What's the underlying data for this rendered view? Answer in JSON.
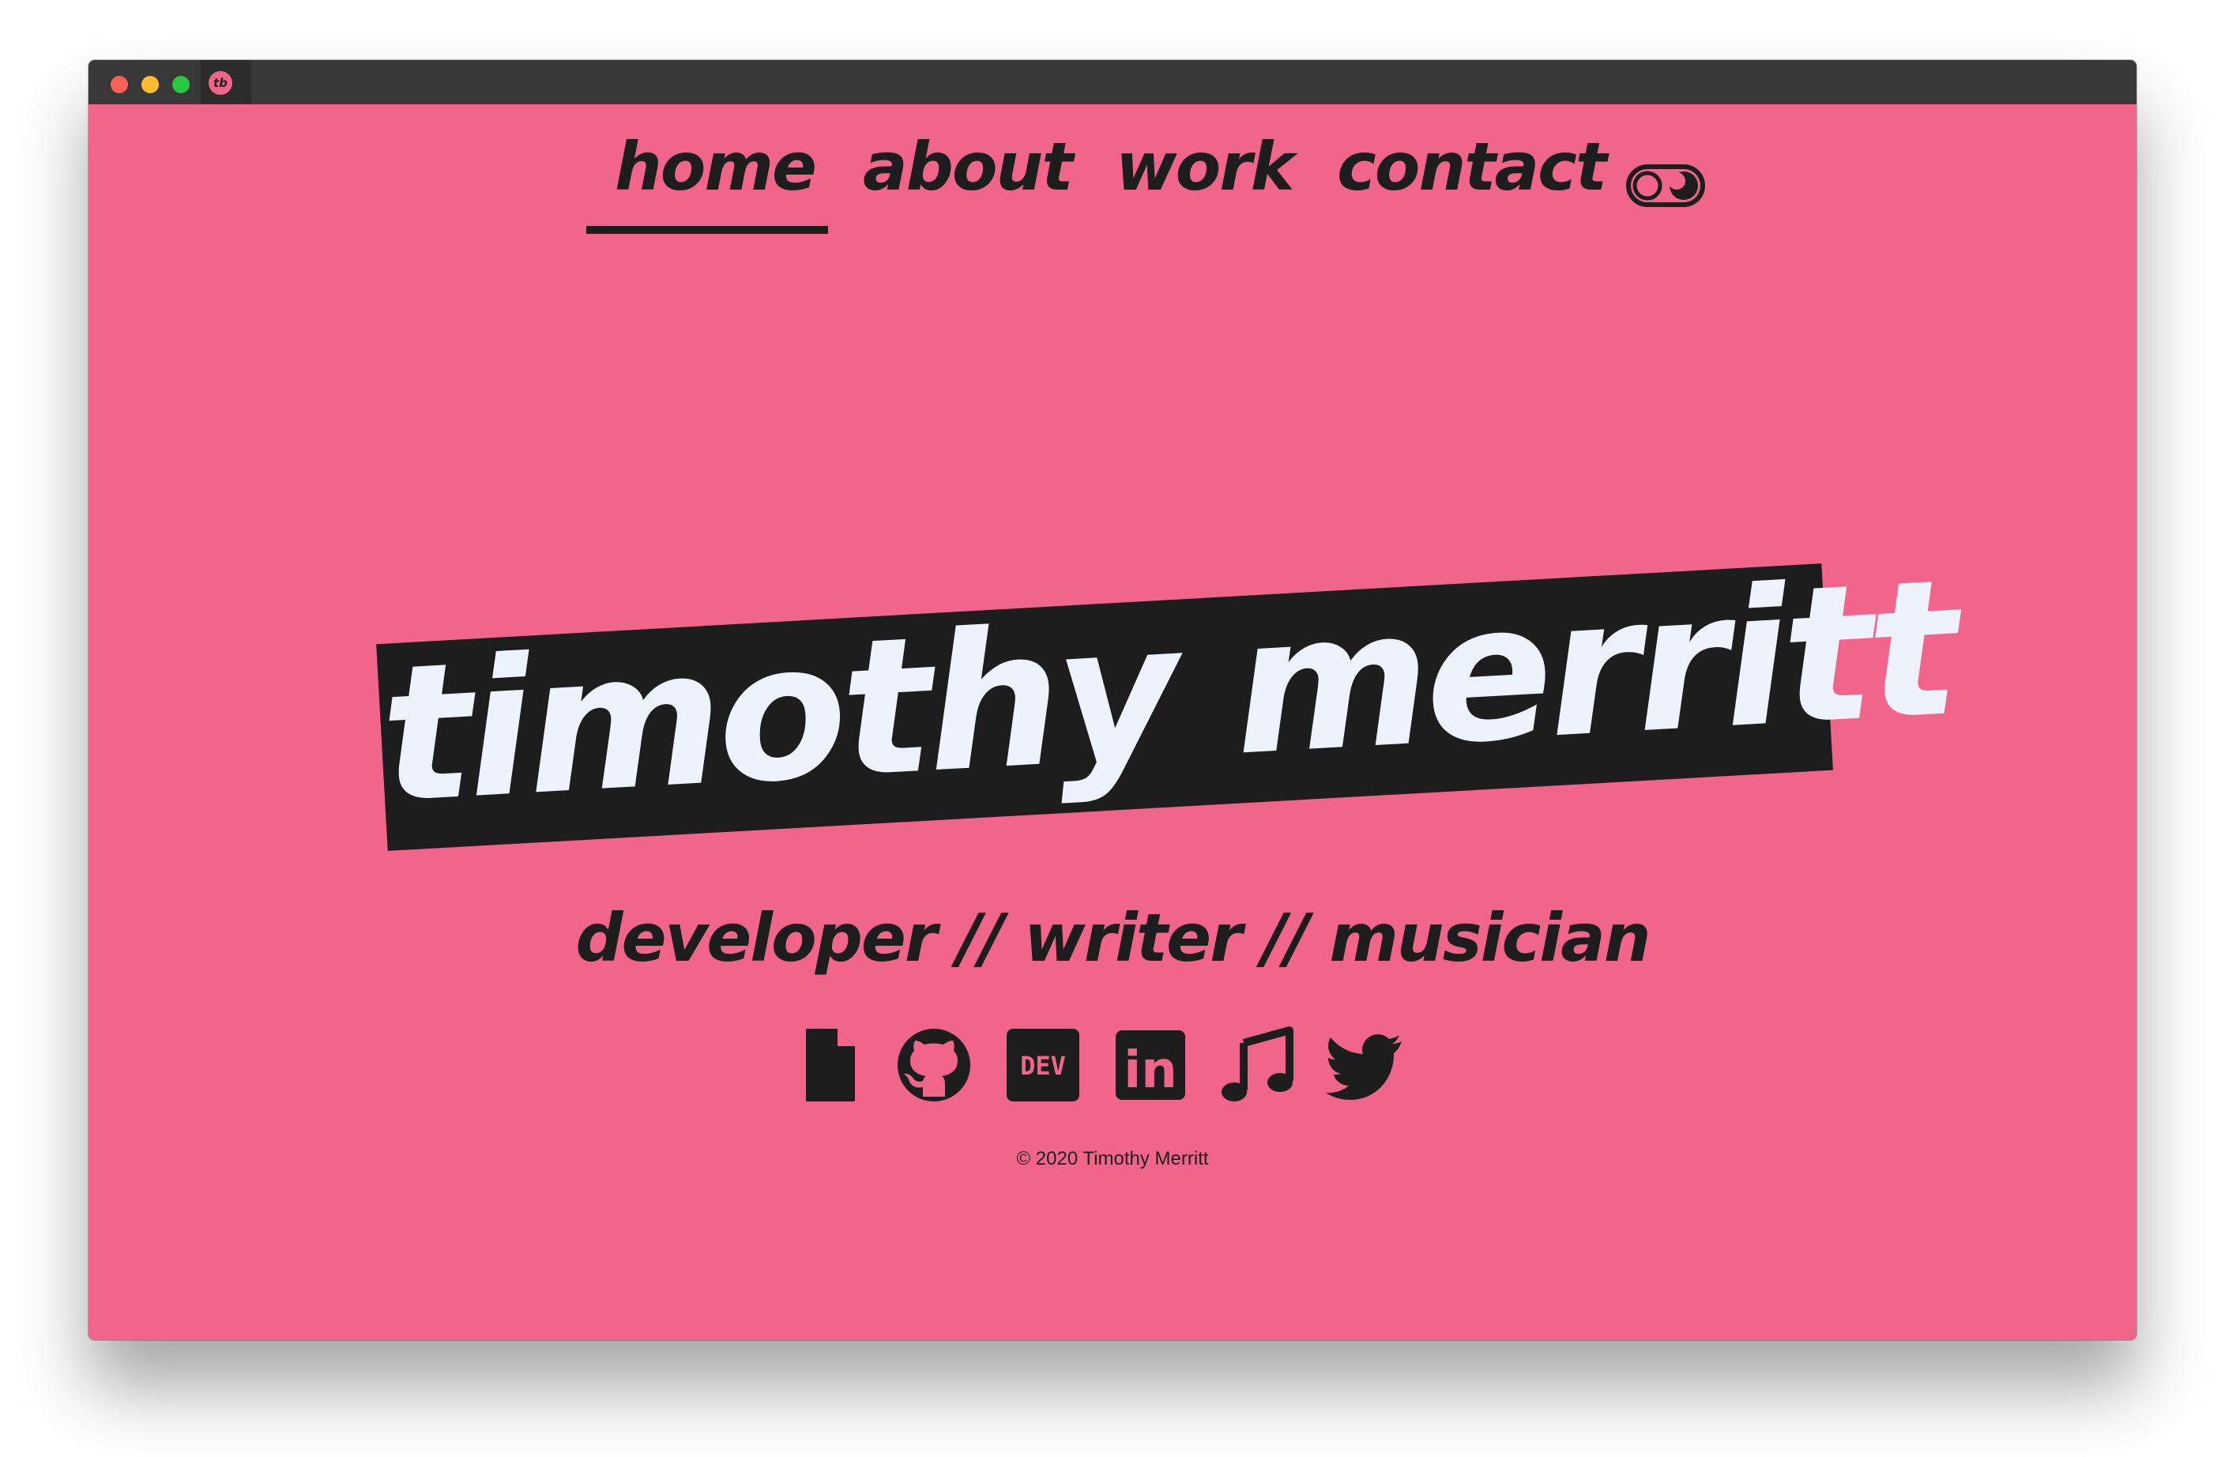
{
  "browser": {
    "favicon_text": "tb"
  },
  "nav": {
    "items": [
      {
        "label": "home",
        "active": true
      },
      {
        "label": "about",
        "active": false
      },
      {
        "label": "work",
        "active": false
      },
      {
        "label": "contact",
        "active": false
      }
    ],
    "theme_toggle_icon": "theme-toggle-icon"
  },
  "hero": {
    "name": "timothy merritt",
    "subtitle": "developer // writer // musician"
  },
  "social": [
    {
      "icon": "file-icon"
    },
    {
      "icon": "github-icon"
    },
    {
      "icon": "dev-icon",
      "text": "DEV"
    },
    {
      "icon": "linkedin-icon",
      "text": "in"
    },
    {
      "icon": "music-icon"
    },
    {
      "icon": "twitter-icon"
    }
  ],
  "footer": {
    "copyright": "© 2020 Timothy Merritt"
  },
  "colors": {
    "background": "#f2658b",
    "ink": "#1d1d1d",
    "hero_text": "#eef2fd",
    "titlebar": "#383838"
  }
}
